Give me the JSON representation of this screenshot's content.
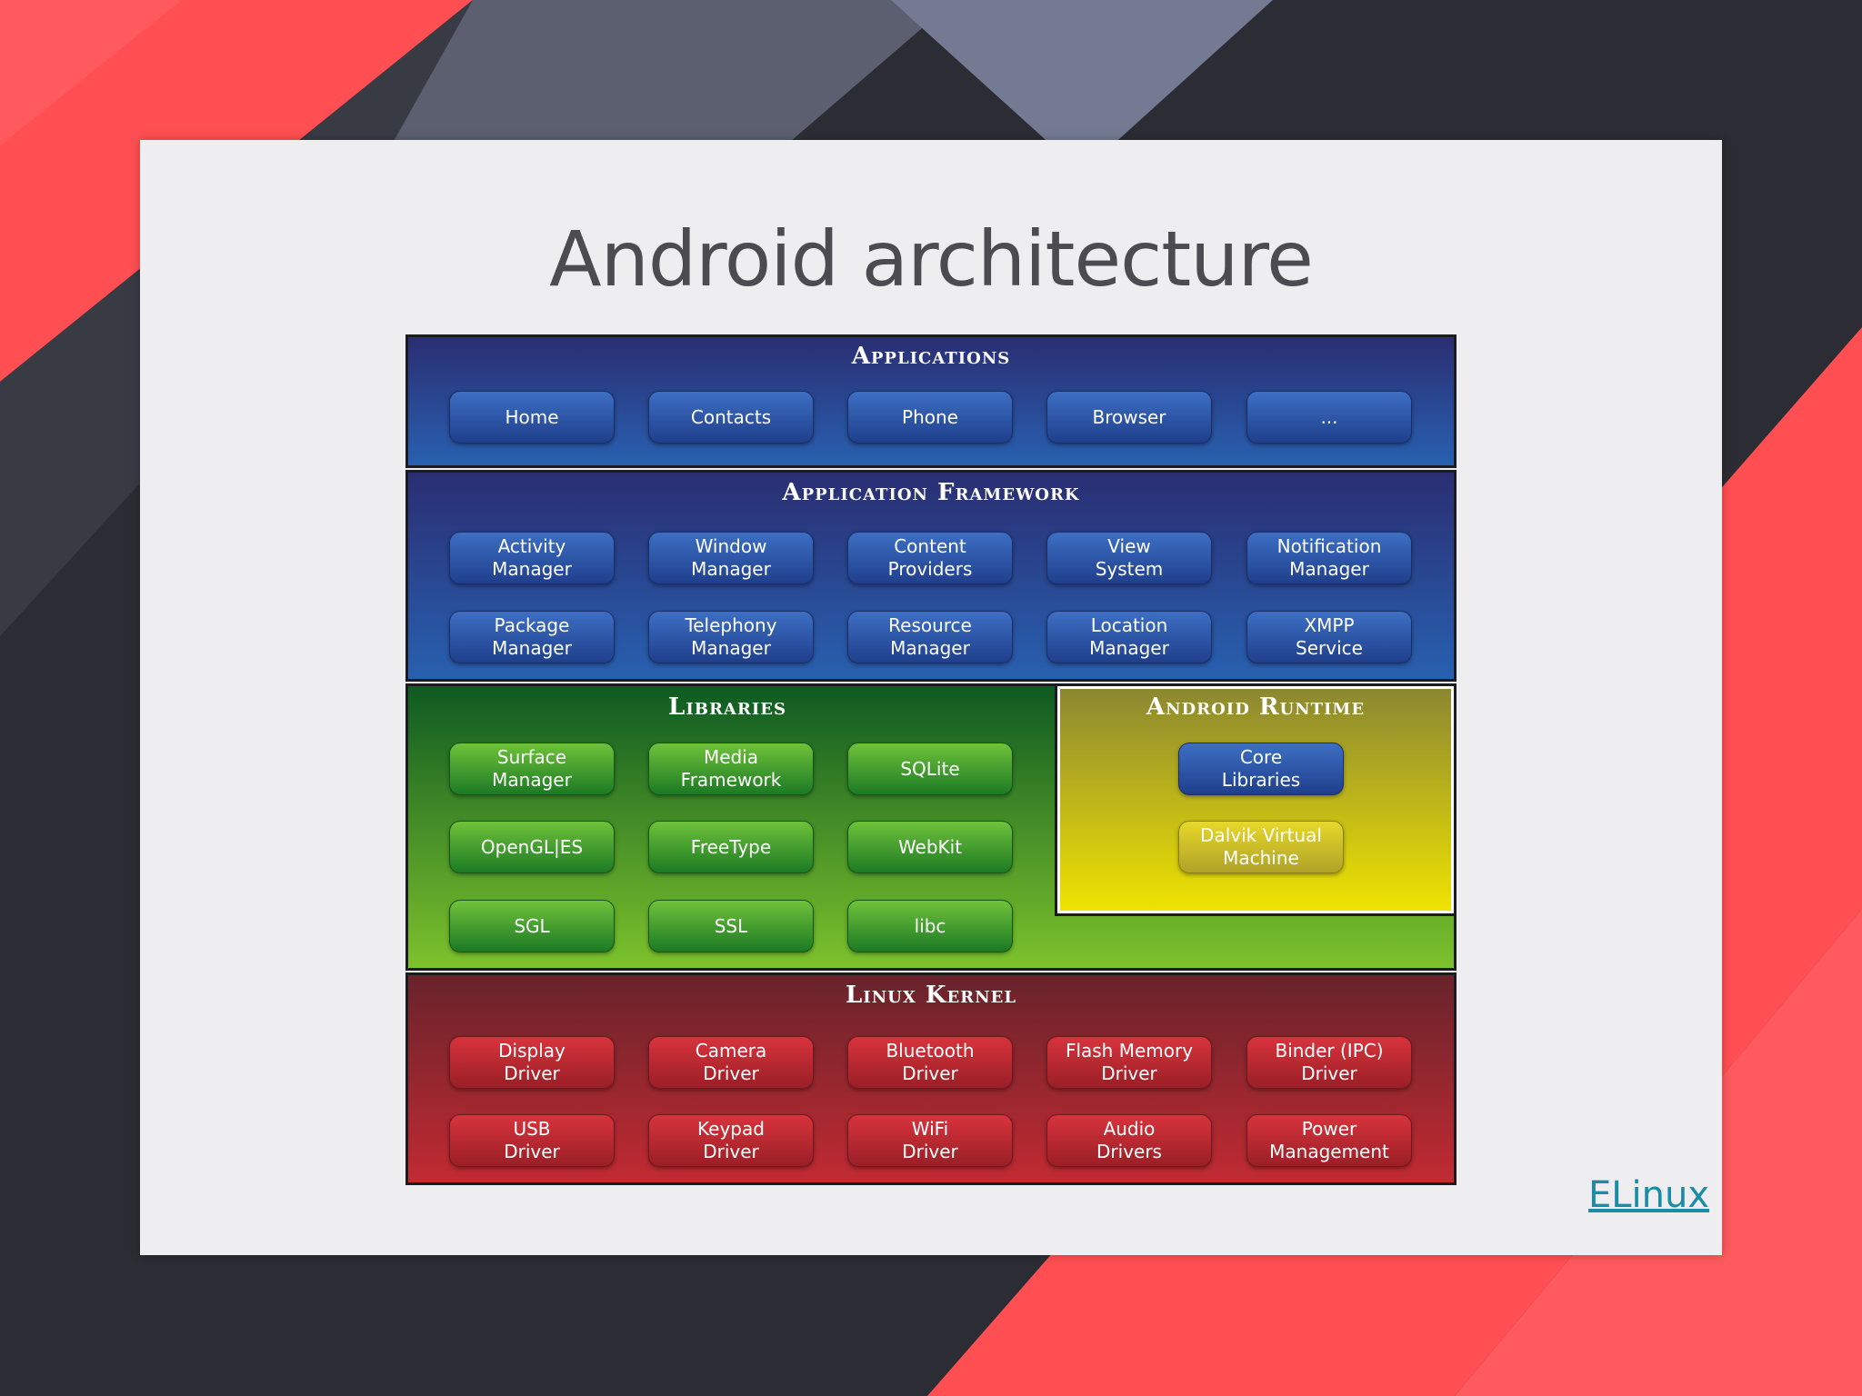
{
  "slide": {
    "title": "Android architecture",
    "source_link": "ELinux"
  },
  "colors": {
    "background": "#2c2d34",
    "accent_red": "#ff4f52",
    "slide": "#eeeef0",
    "link": "#1a8ca6"
  },
  "applications": {
    "title": "Applications",
    "items": [
      "Home",
      "Contacts",
      "Phone",
      "Browser",
      "..."
    ]
  },
  "framework": {
    "title": "Application Framework",
    "items": [
      "Activity\nManager",
      "Window\nManager",
      "Content\nProviders",
      "View\nSystem",
      "Notification\nManager",
      "Package\nManager",
      "Telephony\nManager",
      "Resource\nManager",
      "Location\nManager",
      "XMPP\nService"
    ]
  },
  "libraries": {
    "title": "Libraries",
    "items": [
      "Surface\nManager",
      "Media\nFramework",
      "SQLite",
      "OpenGL|ES",
      "FreeType",
      "WebKit",
      "SGL",
      "SSL",
      "libc"
    ]
  },
  "runtime": {
    "title": "Android Runtime",
    "items": [
      "Core\nLibraries",
      "Dalvik Virtual\nMachine"
    ]
  },
  "kernel": {
    "title": "Linux Kernel",
    "items": [
      "Display\nDriver",
      "Camera\nDriver",
      "Bluetooth\nDriver",
      "Flash Memory\nDriver",
      "Binder (IPC)\nDriver",
      "USB\nDriver",
      "Keypad\nDriver",
      "WiFi\nDriver",
      "Audio\nDrivers",
      "Power\nManagement"
    ]
  }
}
